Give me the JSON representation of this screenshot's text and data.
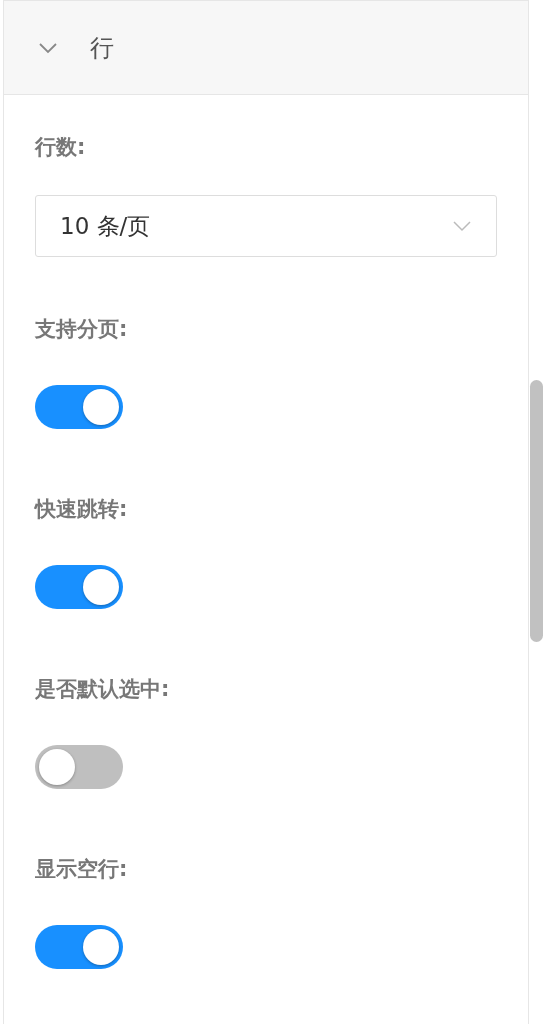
{
  "section": {
    "title": "行",
    "expanded": true
  },
  "fields": [
    {
      "kind": "select",
      "label": "行数:",
      "value": "10 条/页"
    },
    {
      "kind": "switch",
      "label": "支持分页:",
      "on": true
    },
    {
      "kind": "switch",
      "label": "快速跳转:",
      "on": true
    },
    {
      "kind": "switch",
      "label": "是否默认选中:",
      "on": false
    },
    {
      "kind": "switch",
      "label": "显示空行:",
      "on": true
    }
  ]
}
